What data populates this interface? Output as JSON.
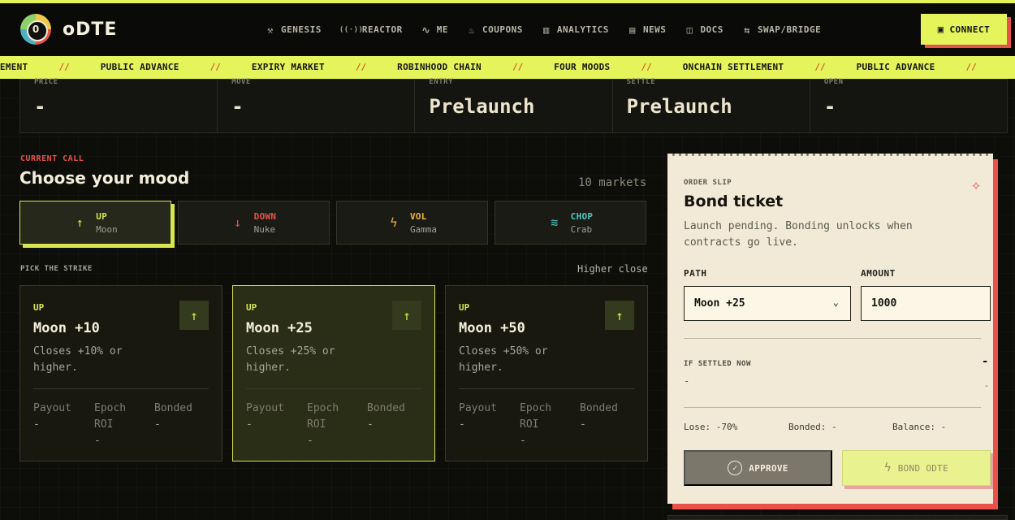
{
  "brand": {
    "mark": "0",
    "name": "oDTE"
  },
  "nav": [
    {
      "label": "GENESIS",
      "icon": "hammer-icon",
      "glyph": "⚒"
    },
    {
      "label": "REACTOR",
      "icon": "broadcast-icon",
      "glyph": "((·))"
    },
    {
      "label": "ME",
      "icon": "pulse-icon",
      "glyph": "∿"
    },
    {
      "label": "COUPONS",
      "icon": "flame-icon",
      "glyph": "♨"
    },
    {
      "label": "ANALYTICS",
      "icon": "bar-chart-icon",
      "glyph": "▥"
    },
    {
      "label": "NEWS",
      "icon": "newspaper-icon",
      "glyph": "▤"
    },
    {
      "label": "DOCS",
      "icon": "book-icon",
      "glyph": "◫"
    },
    {
      "label": "SWAP/BRIDGE",
      "icon": "swap-arrows-icon",
      "glyph": "⇆"
    }
  ],
  "connect": {
    "label": "CONNECT",
    "icon": "wallet-icon"
  },
  "ticker": [
    "ELEMENT",
    "PUBLIC ADVANCE",
    "EXPIRY MARKET",
    "ROBINHOOD CHAIN",
    "FOUR MOODS",
    "ONCHAIN SETTLEMENT",
    "PUBLIC ADVANCE"
  ],
  "ticker_sep": "//",
  "stats": [
    {
      "label": "PRICE",
      "value": "-"
    },
    {
      "label": "MOVE",
      "value": "-"
    },
    {
      "label": "ENTRY",
      "value": "Prelaunch"
    },
    {
      "label": "SETTLE",
      "value": "Prelaunch"
    },
    {
      "label": "OPEN",
      "value": "-"
    }
  ],
  "call": {
    "eyebrow": "CURRENT CALL",
    "title": "Choose your mood",
    "markets": "10 markets"
  },
  "moods": [
    {
      "name": "UP",
      "sub": "Moon",
      "glyph": "↑",
      "color": "#d7e64f",
      "icon": "arrow-up-icon"
    },
    {
      "name": "DOWN",
      "sub": "Nuke",
      "glyph": "↓",
      "color": "#e8524a",
      "icon": "arrow-down-icon"
    },
    {
      "name": "VOL",
      "sub": "Gamma",
      "glyph": "ϟ",
      "color": "#f0b43c",
      "icon": "lightning-icon"
    },
    {
      "name": "CHOP",
      "sub": "Crab",
      "glyph": "≋",
      "color": "#4fc9c0",
      "icon": "waves-icon"
    }
  ],
  "strike_section": {
    "label": "PICK THE STRIKE",
    "hint": "Higher close"
  },
  "strikes": [
    {
      "dir": "UP",
      "name": "Moon +10",
      "desc": "Closes +10% or higher.",
      "payout_label": "Payout",
      "payout": "-",
      "roi_label": "Epoch ROI",
      "roi": "-",
      "bonded_label": "Bonded",
      "bonded": "-"
    },
    {
      "dir": "UP",
      "name": "Moon +25",
      "desc": "Closes +25% or higher.",
      "payout_label": "Payout",
      "payout": "-",
      "roi_label": "Epoch ROI",
      "roi": "-",
      "bonded_label": "Bonded",
      "bonded": "-"
    },
    {
      "dir": "UP",
      "name": "Moon +50",
      "desc": "Closes +50% or higher.",
      "payout_label": "Payout",
      "payout": "-",
      "roi_label": "Epoch ROI",
      "roi": "-",
      "bonded_label": "Bonded",
      "bonded": "-"
    }
  ],
  "slip": {
    "eyebrow": "ORDER SLIP",
    "title": "Bond ticket",
    "note": "Launch pending. Bonding unlocks when contracts go live.",
    "path_label": "PATH",
    "path_value": "Moon +25",
    "amount_label": "AMOUNT",
    "amount_value": "1000",
    "settled_label": "IF SETTLED NOW",
    "settled_big": "-",
    "settled_left": "-",
    "settled_right": "-",
    "lose": "Lose: -70%",
    "bonded": "Bonded: -",
    "balance": "Balance: -",
    "approve_label": "APPROVE",
    "bond_label": "BOND ODTE"
  },
  "colors": {
    "accent": "#e4f45a",
    "alert": "#e8524a",
    "slip_bg": "#f2ead6"
  }
}
